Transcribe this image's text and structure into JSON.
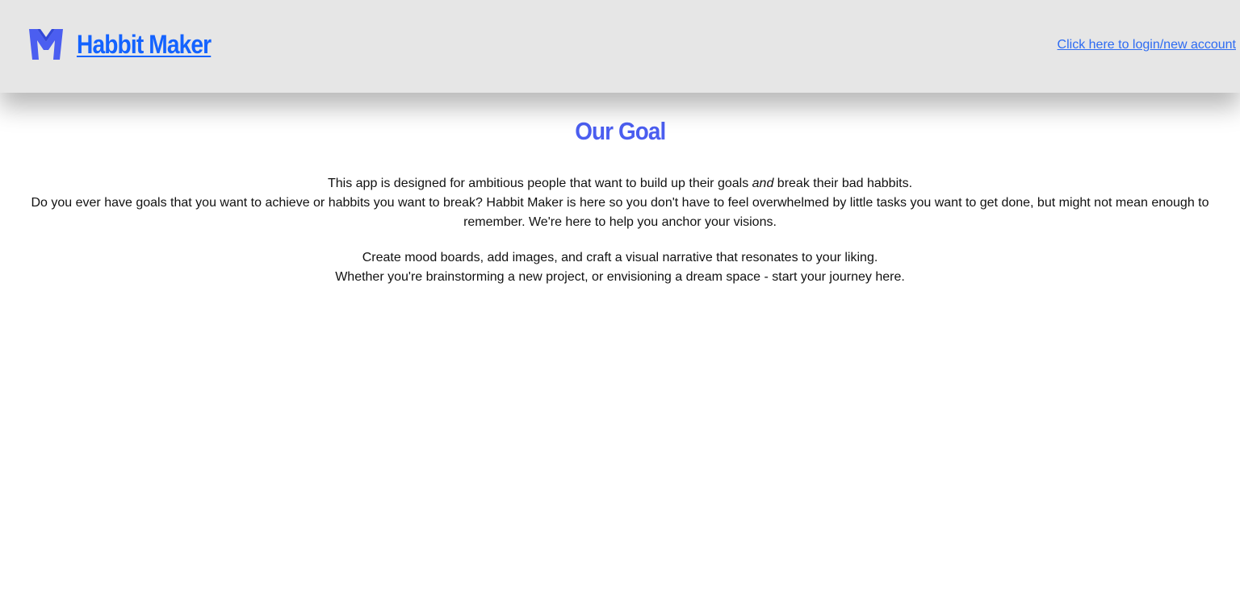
{
  "header": {
    "logo_icon": "m-letter-logo-icon",
    "title": "Habbit Maker",
    "login_link": "Click here to login/new account",
    "accent_color": "#1463ff",
    "background": "#e6e6e6"
  },
  "main": {
    "title": "Our Goal",
    "title_color": "#4b5ef0",
    "paragraph1": {
      "line1_a": "This app is designed for ambitious people that want to build up their goals ",
      "line1_em": "and",
      "line1_b": " break their bad habbits.",
      "line2": "Do you ever have goals that you want to achieve or habbits you want to break? Habbit Maker is here so you don't have to feel overwhelmed by little tasks you want to get done, but might not mean enough to remember. We're here to help you anchor your visions."
    },
    "paragraph2": {
      "line1": "Create mood boards, add images, and craft a visual narrative that resonates to your liking.",
      "line2": "Whether you're brainstorming a new project, or envisioning a dream space - start your journey here."
    }
  }
}
